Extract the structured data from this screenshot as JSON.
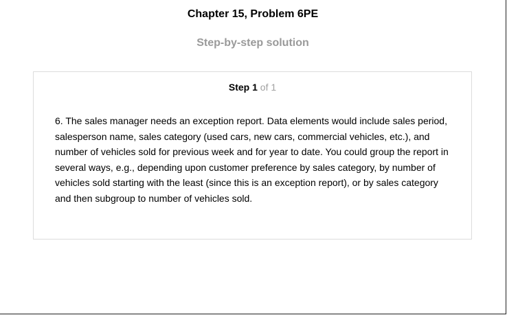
{
  "header": {
    "chapter_title": "Chapter 15, Problem 6PE",
    "subtitle": "Step-by-step solution"
  },
  "step": {
    "label": "Step",
    "number": "1",
    "of_text": "of 1",
    "body": "6. The sales manager needs an exception report. Data elements would include sales period, salesperson name, sales category (used cars, new cars, commercial vehicles, etc.), and number of vehicles sold for previous week and for year to date. You could group the report in several ways, e.g., depending upon customer preference by sales category, by number of vehicles sold starting with the least (since this is an exception report), or by sales category and then subgroup to number of vehicles sold."
  }
}
